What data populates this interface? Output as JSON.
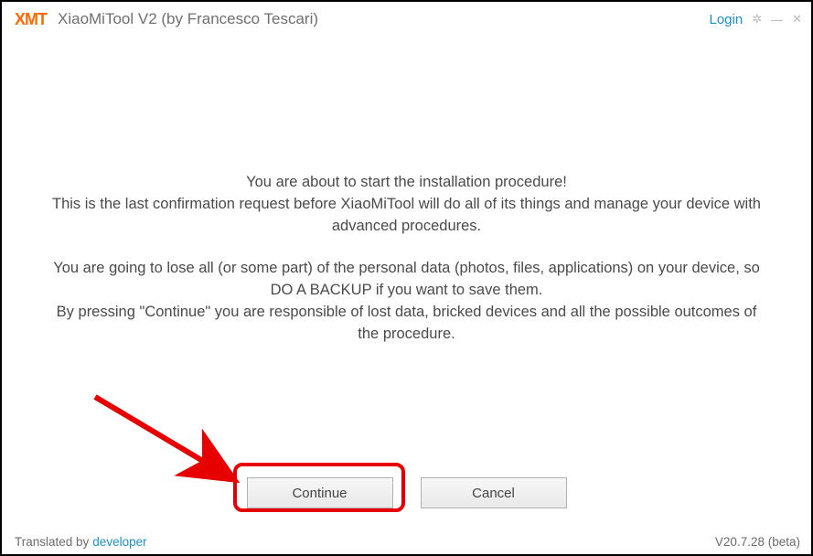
{
  "header": {
    "logo": "XMT",
    "title": "XiaoMiTool V2 (by Francesco Tescari)",
    "login": "Login"
  },
  "body": {
    "line1": "You are about to start the installation procedure!",
    "line2": "This is the last confirmation request before XiaoMiTool will do all of its things and manage your device with advanced procedures.",
    "line3": "You are going to lose all (or some part) of the personal data (photos, files, applications) on your device, so DO A BACKUP if you want to save them.",
    "line4": "By pressing \"Continue\" you are responsible of lost data, bricked devices and all the possible outcomes of the procedure."
  },
  "buttons": {
    "continue": "Continue",
    "cancel": "Cancel"
  },
  "footer": {
    "translated_prefix": "Translated by",
    "developer": "developer",
    "version": "V20.7.28 (beta)"
  },
  "annotation": {
    "highlight_target": "continue-button"
  }
}
